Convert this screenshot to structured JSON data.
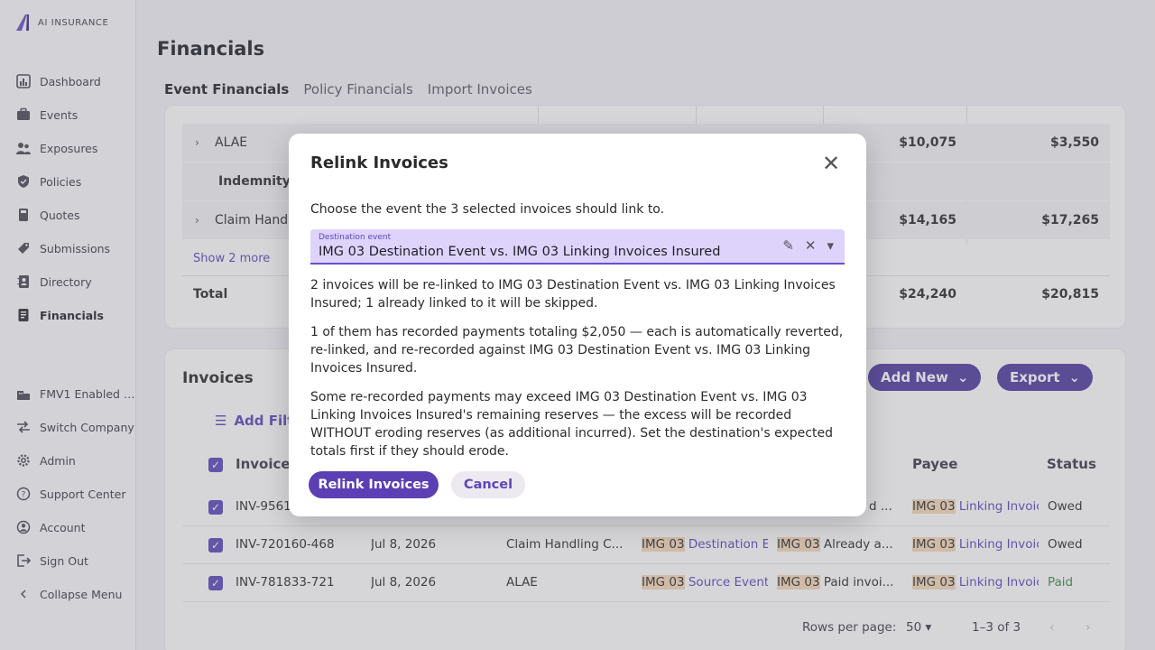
{
  "app": {
    "logo_text": "AI INSURANCE"
  },
  "sidebar": {
    "items": [
      {
        "label": "Dashboard",
        "icon": "bar-chart-icon"
      },
      {
        "label": "Events",
        "icon": "briefcase-icon"
      },
      {
        "label": "Exposures",
        "icon": "people-icon"
      },
      {
        "label": "Policies",
        "icon": "shield-icon"
      },
      {
        "label": "Quotes",
        "icon": "calculator-icon"
      },
      {
        "label": "Submissions",
        "icon": "tag-icon"
      },
      {
        "label": "Directory",
        "icon": "contacts-icon"
      },
      {
        "label": "Financials",
        "icon": "receipt-icon"
      }
    ],
    "bottom": [
      {
        "label": "FMV1 Enabled …",
        "icon": "building-icon"
      },
      {
        "label": "Switch Company",
        "icon": "swap-icon"
      },
      {
        "label": "Admin",
        "icon": "gear-icon"
      },
      {
        "label": "Support Center",
        "icon": "help-icon"
      },
      {
        "label": "Account",
        "icon": "account-icon"
      },
      {
        "label": "Sign Out",
        "icon": "signout-icon"
      },
      {
        "label": "Collapse Menu",
        "icon": "chevron-left-icon"
      }
    ]
  },
  "page": {
    "title": "Financials",
    "tabs": [
      "Event Financials",
      "Policy Financials",
      "Import Invoices"
    ]
  },
  "financials_table": {
    "rows": [
      {
        "label": "ALAE",
        "v1": "$10,075",
        "v2": "$3,550"
      },
      {
        "label": "Indemnity",
        "v1": "",
        "v2": ""
      },
      {
        "label": "Claim Handl",
        "v1": "$14,165",
        "v2": "$17,265"
      }
    ],
    "show_more": "Show 2 more",
    "total": {
      "label": "Total",
      "v1": "$24,240",
      "v2": "$20,815"
    }
  },
  "invoices": {
    "title": "Invoices",
    "add_new": "Add New",
    "export": "Export",
    "add_filter": "Add Filt",
    "headers": {
      "invoice": "Invoice",
      "payee": "Payee",
      "status": "Status"
    },
    "rows": [
      {
        "id": "INV-9561",
        "date": "",
        "category": "",
        "event": "",
        "note_tag": "",
        "note": "d ...",
        "payee_tag": "IMG 03",
        "payee": "Linking Invoic",
        "status": "Owed"
      },
      {
        "id": "INV-720160-468",
        "date": "Jul 8, 2026",
        "category": "Claim Handling C...",
        "event_tag": "IMG 03",
        "event": "Destination Ev",
        "note_tag": "IMG 03",
        "note": "Already a...",
        "payee_tag": "IMG 03",
        "payee": "Linking Invoic",
        "status": "Owed"
      },
      {
        "id": "INV-781833-721",
        "date": "Jul 8, 2026",
        "category": "ALAE",
        "event_tag": "IMG 03",
        "event": "Source Event",
        "note_tag": "IMG 03",
        "note": "Paid invoi...",
        "payee_tag": "IMG 03",
        "payee": "Linking Invoic",
        "status": "Paid"
      }
    ],
    "pager": {
      "rows_label": "Rows per page:",
      "rows_value": "50",
      "range": "1–3 of 3"
    }
  },
  "dialog": {
    "title": "Relink Invoices",
    "intro": "Choose the event the 3 selected invoices should link to.",
    "field_label": "Destination event",
    "field_value": "IMG 03 Destination Event vs. IMG 03 Linking Invoices Insured",
    "p1": "2 invoices will be re-linked to IMG 03 Destination Event vs. IMG 03 Linking Invoices Insured; 1 already linked to it will be skipped.",
    "p2": "1 of them has recorded payments totaling $2,050 — each is automatically reverted, re-linked, and re-recorded against IMG 03 Destination Event vs. IMG 03 Linking Invoices Insured.",
    "p3": "Some re-recorded payments may exceed IMG 03 Destination Event vs. IMG 03 Linking Invoices Insured's remaining reserves — the excess will be recorded WITHOUT eroding reserves (as additional incurred). Set the destination's expected totals first if they should erode.",
    "confirm": "Relink Invoices",
    "cancel": "Cancel"
  }
}
